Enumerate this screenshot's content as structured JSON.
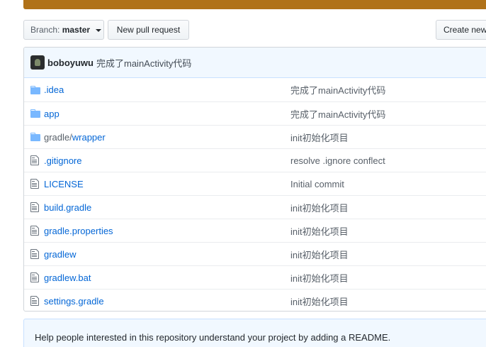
{
  "language_bar": {
    "segments": [
      {
        "color": "#b07219",
        "share": 1.0
      }
    ]
  },
  "toolbar": {
    "branch_prefix": "Branch:",
    "branch_name": "master",
    "new_pull_request": "New pull request",
    "create_new": "Create new"
  },
  "latest_commit": {
    "author": "boboyuwu",
    "message": "完成了mainActivity代码"
  },
  "files": [
    {
      "type": "dir",
      "prefix": "",
      "name": ".idea",
      "message": "完成了mainActivity代码"
    },
    {
      "type": "dir",
      "prefix": "",
      "name": "app",
      "message": "完成了mainActivity代码"
    },
    {
      "type": "dir",
      "prefix": "gradle/",
      "name": "wrapper",
      "message": "init初始化项目"
    },
    {
      "type": "file",
      "prefix": "",
      "name": ".gitignore",
      "message": "resolve .ignore conflect"
    },
    {
      "type": "file",
      "prefix": "",
      "name": "LICENSE",
      "message": "Initial commit"
    },
    {
      "type": "file",
      "prefix": "",
      "name": "build.gradle",
      "message": "init初始化项目"
    },
    {
      "type": "file",
      "prefix": "",
      "name": "gradle.properties",
      "message": "init初始化项目"
    },
    {
      "type": "file",
      "prefix": "",
      "name": "gradlew",
      "message": "init初始化项目"
    },
    {
      "type": "file",
      "prefix": "",
      "name": "gradlew.bat",
      "message": "init初始化项目"
    },
    {
      "type": "file",
      "prefix": "",
      "name": "settings.gradle",
      "message": "init初始化项目"
    }
  ],
  "readme_prompt": "Help people interested in this repository understand your project by adding a README.",
  "colors": {
    "link": "#0366d6",
    "folder_icon": "#79b8ff",
    "file_icon": "#6a737d",
    "commit_bar_bg": "#f1f8ff"
  }
}
